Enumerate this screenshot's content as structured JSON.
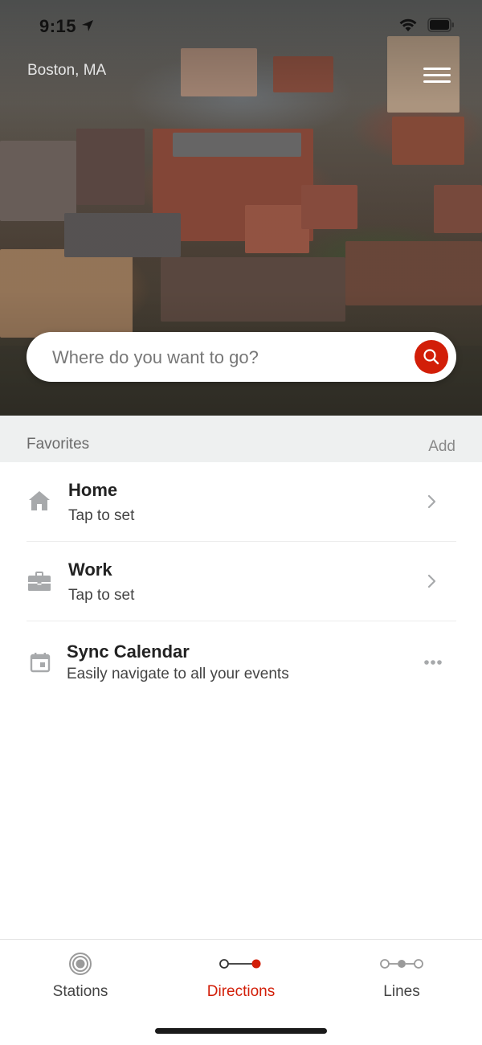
{
  "status_bar": {
    "time": "9:15"
  },
  "header": {
    "city": "Boston, MA",
    "menu_icon": "hamburger-menu-icon"
  },
  "search": {
    "placeholder": "Where do you want to go?",
    "button_icon": "search-icon"
  },
  "favorites": {
    "title": "Favorites",
    "add_label": "Add",
    "items": [
      {
        "icon": "home-icon",
        "title": "Home",
        "subtitle": "Tap to set",
        "action_icon": "chevron-right-icon"
      },
      {
        "icon": "briefcase-icon",
        "title": "Work",
        "subtitle": "Tap to set",
        "action_icon": "chevron-right-icon"
      },
      {
        "icon": "calendar-icon",
        "title": "Sync Calendar",
        "subtitle": "Easily navigate to all your events",
        "action_icon": "more-icon"
      }
    ]
  },
  "tabs": [
    {
      "label": "Stations",
      "icon": "station-icon",
      "active": false
    },
    {
      "label": "Directions",
      "icon": "directions-icon",
      "active": true
    },
    {
      "label": "Lines",
      "icon": "lines-icon",
      "active": false
    }
  ],
  "colors": {
    "accent": "#d21e08",
    "section_bg": "#eef0f0",
    "icon_gray": "#a7a9ab"
  }
}
